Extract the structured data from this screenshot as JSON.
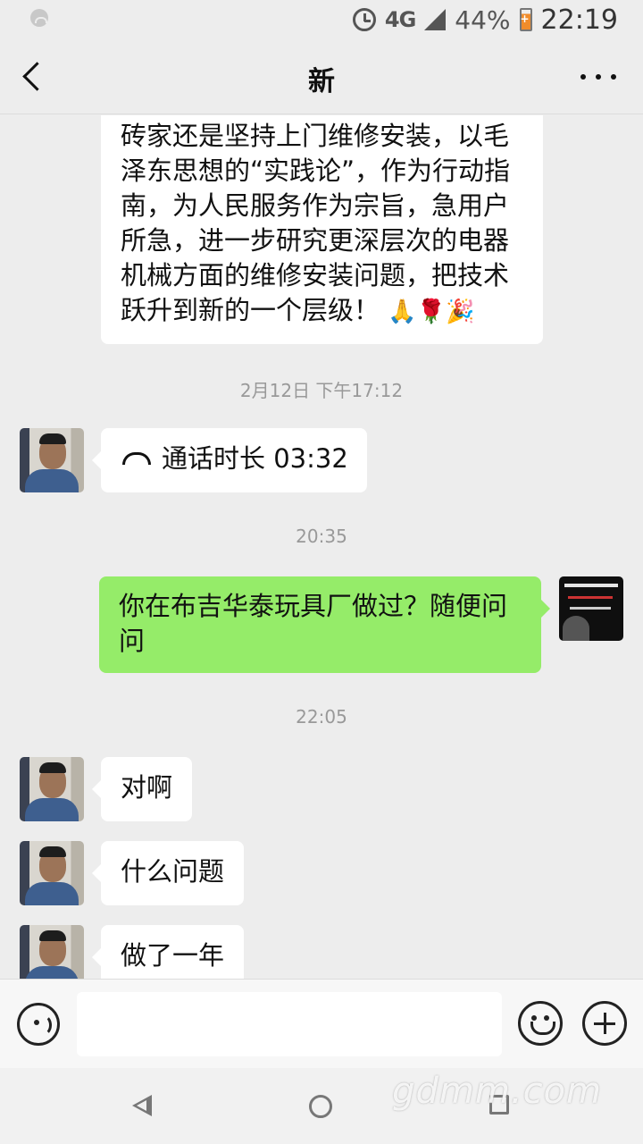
{
  "status_bar": {
    "network": "4G",
    "battery_percent": "44%",
    "time": "22:19"
  },
  "header": {
    "title": "新"
  },
  "messages": {
    "m1_lines": [
      "砖家还是坚持上门维修安装，以毛",
      "泽东思想的“实践论”，作为行动指",
      "南，为人民服务作为宗旨，急用户",
      "所急，进一步研究更深层次的电器",
      "机械方面的维修安装问题，把技术",
      "跃升到新的一个层级！"
    ],
    "m1_emoji": "🙏🌹🎉",
    "ts1": "2月12日 下午17:12",
    "call": "通话时长 03:32",
    "ts2": "20:35",
    "mine_lines": [
      "你在布吉华泰玩具厂做过？随便问",
      "问"
    ],
    "ts3": "22:05",
    "m3": "对啊",
    "m4": "什么问题",
    "m5": "做了一年"
  },
  "icons": {
    "back": "chevron-left-icon",
    "more": "more-dots-icon",
    "voice": "voice-icon",
    "emoji": "emoji-icon",
    "plus": "plus-icon",
    "call": "phone-icon"
  },
  "colors": {
    "mine_bubble": "#95ec69",
    "their_bubble": "#ffffff",
    "background": "#ededed"
  },
  "watermark": "gdmm.com"
}
